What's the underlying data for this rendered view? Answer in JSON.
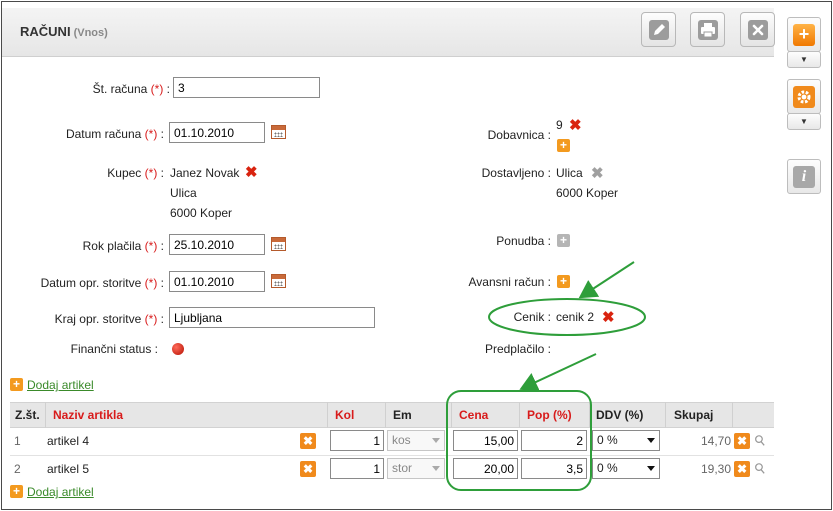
{
  "header": {
    "title": "RAČUNI",
    "subtitle": "(Vnos)"
  },
  "toolbar": {
    "edit_icon": "pencil-icon",
    "print_icon": "printer-icon",
    "close_icon": "close-icon"
  },
  "sidebar": {
    "add_icon": "plus-icon",
    "settings_icon": "gear-icon",
    "info_icon": "info-icon",
    "add_glyph": "+",
    "info_glyph": "i"
  },
  "form": {
    "required_marker": "(*)",
    "st_racuna": {
      "label": "Št. računa",
      "value": "3"
    },
    "datum_racuna": {
      "label": "Datum računa",
      "value": "01.10.2010"
    },
    "kupec": {
      "label": "Kupec",
      "lines": [
        "Janez Novak",
        "Ulica",
        "6000 Koper"
      ]
    },
    "rok_placila": {
      "label": "Rok plačila",
      "value": "25.10.2010"
    },
    "datum_opr": {
      "label": "Datum opr. storitve",
      "value": "01.10.2010"
    },
    "kraj_opr": {
      "label": "Kraj opr. storitve",
      "value": "Ljubljana"
    },
    "financni_status": {
      "label": "Finančni status :"
    },
    "dobavnica": {
      "label": "Dobavnica :",
      "value": "9"
    },
    "dostavljeno": {
      "label": "Dostavljeno :",
      "lines": [
        "Ulica",
        "6000 Koper"
      ]
    },
    "ponudba": {
      "label": "Ponudba :"
    },
    "avansni": {
      "label": "Avansni račun :"
    },
    "cenik": {
      "label": "Cenik :",
      "value": "cenik 2"
    },
    "predplacilo": {
      "label": "Predplačilo :"
    }
  },
  "actions": {
    "dodaj_artikel": "Dodaj artikel"
  },
  "table": {
    "headers": {
      "zst": "Z.št.",
      "naziv": "Naziv artikla",
      "kol": "Kol",
      "em": "Em",
      "cena": "Cena",
      "pop": "Pop (%)",
      "ddv": "DDV (%)",
      "skupaj": "Skupaj"
    },
    "rows": [
      {
        "zst": "1",
        "naziv": "artikel 4",
        "kol": "1",
        "em": "kos",
        "cena": "15,00",
        "pop": "2",
        "ddv": "0 %",
        "skupaj": "14,70"
      },
      {
        "zst": "2",
        "naziv": "artikel 5",
        "kol": "1",
        "em": "stor",
        "cena": "20,00",
        "pop": "3,5",
        "ddv": "0 %",
        "skupaj": "19,30"
      }
    ]
  },
  "colors": {
    "accent_orange": "#f39a1f",
    "required_red": "#d81b1b",
    "link_green": "#3a8a2a",
    "highlight_green": "#2e9e3a"
  },
  "glyphs": {
    "plus": "+",
    "close": "✖",
    "paperclip": "⚲"
  }
}
